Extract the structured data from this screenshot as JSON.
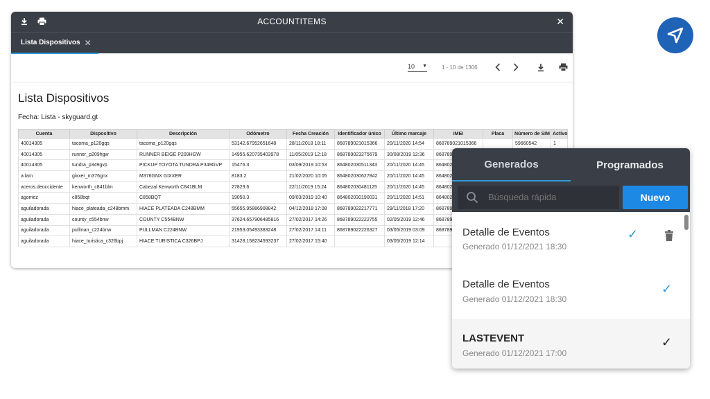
{
  "window": {
    "title": "ACCOUNTITEMS",
    "download_icon": "download-icon",
    "print_icon": "print-icon",
    "close_icon": "close-icon",
    "tab": {
      "label": "Lista Dispositivos"
    }
  },
  "toolbar": {
    "page_size": "10",
    "page_range": "1 - 10 de 1306"
  },
  "report": {
    "title": "Lista Dispositivos",
    "fecha": "Fecha: Lista - skyguard.gt",
    "columns": [
      "Cuenta",
      "Dispositivo",
      "Descripción",
      "Odómetro",
      "Fecha Creación",
      "Identificador único",
      "Último marcaje",
      "IMEI",
      "Placa",
      "Número de SIM",
      "Activo"
    ],
    "rows": [
      [
        "40014305",
        "tacoma_p120gqs",
        "tacoma_p120gqs",
        "53142.67952651648",
        "28/11/2018 18:11",
        "868789021015366",
        "20/11/2020 14:54",
        "868789021015366",
        "",
        "59660542",
        "1"
      ],
      [
        "40014305",
        "runner_p209hgw",
        "RUNNER BEIGE P209HGW",
        "14955.620735403978",
        "11/05/2019 12:18",
        "868789023275679",
        "30/08/2019 12:36",
        "868789",
        "",
        "",
        ""
      ],
      [
        "40014305",
        "tundra_p349gvp",
        "PICKUP TOYOTA TUNDRA P349GVP",
        "15476.3",
        "03/09/2019 10:53",
        "864802030511343",
        "20/11/2020 14:45",
        "864802",
        "",
        "",
        ""
      ],
      [
        "a.lam",
        "gixxer_m376gnx",
        "M376GNX GIXXER",
        "8183.2",
        "21/02/2020 10:05",
        "864802030627842",
        "20/11/2020 14:45",
        "864802",
        "",
        "",
        ""
      ],
      [
        "aceros.deoccidente",
        "kenworth_c841blm",
        "Cabezal Kenworth C841BLM",
        "27829.6",
        "22/11/2019 15:24",
        "864802030481125",
        "20/11/2020 14:45",
        "864802",
        "",
        "",
        ""
      ],
      [
        "agomez",
        "c858bqt",
        "C858BQT",
        "19050.3",
        "09/03/2019 10:40",
        "864802030190031",
        "20/11/2020 14:51",
        "864802",
        "",
        "",
        ""
      ],
      [
        "aguiladorada",
        "hiace_plateada_c248bmm",
        "HIACE PLATEADA C248BMM",
        "55655.95886908842",
        "04/12/2018 17:08",
        "868789022217771",
        "29/11/2018 17:20",
        "868789",
        "",
        "",
        ""
      ],
      [
        "aguiladorada",
        "county_c554bnw",
        "COUNTY C554BNW",
        "37624.657906485816",
        "27/02/2017 14:26",
        "868789022222755",
        "02/05/2019 12:46",
        "868789",
        "",
        "",
        ""
      ],
      [
        "aguiladorada",
        "pullman_c224bnw",
        "PULLMAN C224BNW",
        "21953.05493383248",
        "27/02/2017 14:11",
        "868789022226327",
        "03/05/2019 03:09",
        "868789",
        "",
        "",
        ""
      ],
      [
        "aguiladorada",
        "hiace_turistica_c326bpj",
        "HIACE TURISTICA C326BPJ",
        "31428.158234593237",
        "27/02/2017 15:40",
        "",
        "03/05/2019 12:14",
        "",
        "",
        "",
        ""
      ]
    ]
  },
  "panel": {
    "tabs": [
      "Generados",
      "Programados"
    ],
    "search_placeholder": "Búsqueda rápida",
    "new_button": "Nuevo",
    "items": [
      {
        "name": "Detalle de Eventos",
        "sub": "Generado 01/12/2021 18:30",
        "check_color": "#2f9bd9"
      },
      {
        "name": "Detalle de Eventos",
        "sub": "Generado 01/12/2021 18:30",
        "check_color": "#2f9bd9"
      },
      {
        "name": "LASTEVENT",
        "sub": "Generado 01/12/2021 17:00",
        "check_color": "#222222"
      }
    ]
  },
  "colors": {
    "header": "#3a3f47",
    "accent": "#2f9bd9",
    "button": "#1e88e5",
    "logo": "#1f63b7"
  },
  "logo_icon": "navigation-arrow-icon"
}
